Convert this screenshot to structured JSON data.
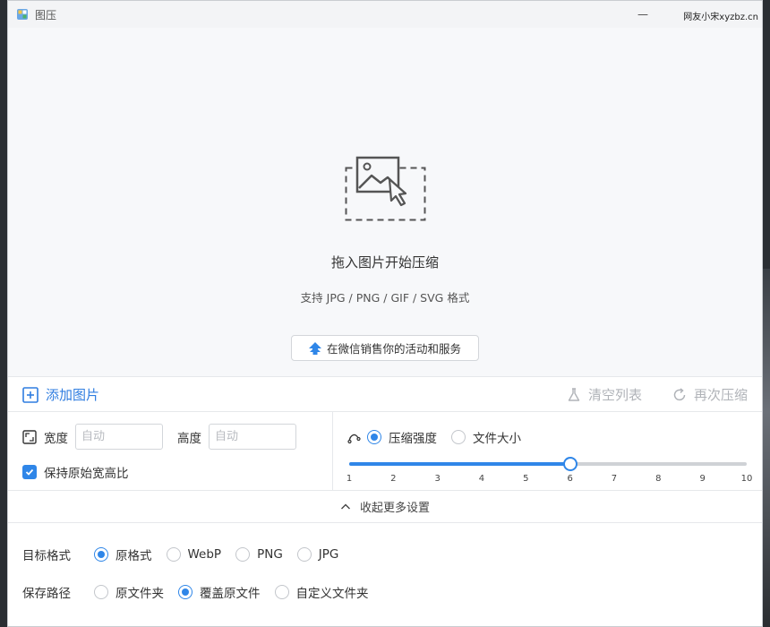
{
  "app": {
    "title": "图压",
    "watermark": "网友小宋xyzbz.cn",
    "minimize_glyph": "—"
  },
  "dropzone": {
    "title": "拖入图片开始压缩",
    "subtitle": "支持 JPG / PNG / GIF / SVG 格式",
    "promo_label": "在微信销售你的活动和服务",
    "graphic_icon": "image-drop-icon"
  },
  "toolbar": {
    "add_label": "添加图片",
    "clear_label": "清空列表",
    "recompress_label": "再次压缩"
  },
  "resize": {
    "width_label": "宽度",
    "width_placeholder": "自动",
    "height_label": "高度",
    "height_placeholder": "自动",
    "keep_ratio_label": "保持原始宽高比",
    "keep_ratio_checked": true
  },
  "compress": {
    "mode_strength_label": "压缩强度",
    "mode_size_label": "文件大小",
    "selected_mode": "strength",
    "slider_min": 1,
    "slider_max": 10,
    "slider_value": 6,
    "ticks": [
      "1",
      "2",
      "3",
      "4",
      "5",
      "6",
      "7",
      "8",
      "9",
      "10"
    ],
    "accent_color": "#2f86e8"
  },
  "collapse": {
    "label": "收起更多设置"
  },
  "format": {
    "label": "目标格式",
    "options": [
      "原格式",
      "WebP",
      "PNG",
      "JPG"
    ],
    "selected": "原格式"
  },
  "save": {
    "label": "保存路径",
    "options": [
      "原文件夹",
      "覆盖原文件",
      "自定义文件夹"
    ],
    "selected": "覆盖原文件"
  }
}
